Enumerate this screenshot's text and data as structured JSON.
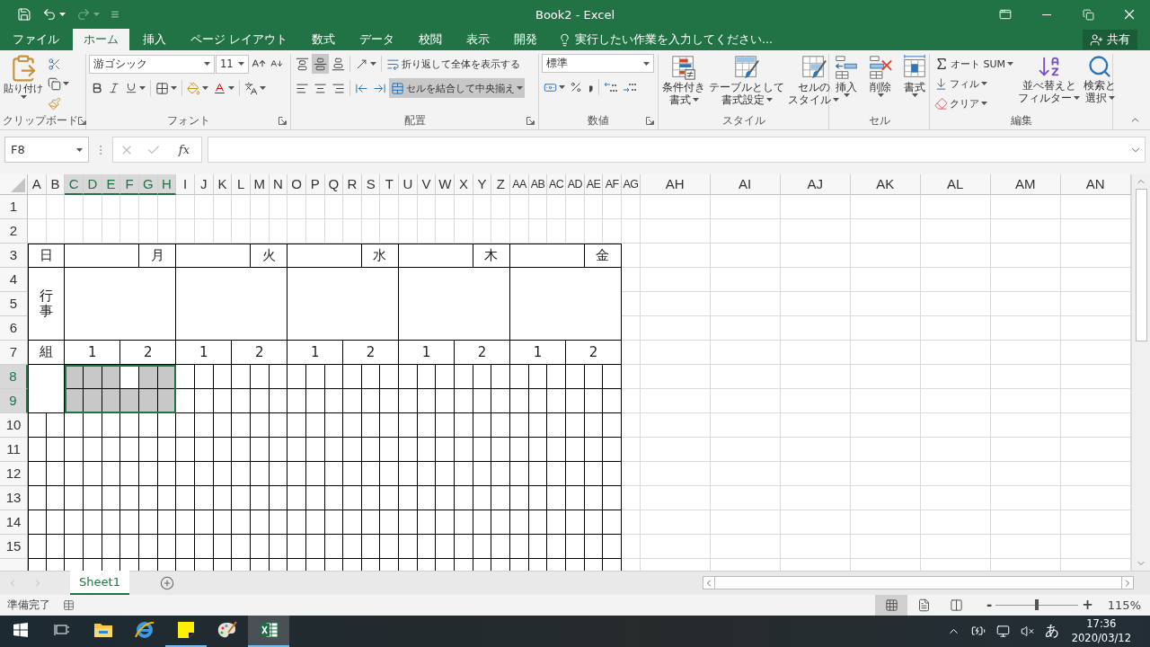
{
  "quick_access": [
    {
      "kind": "save",
      "disabled": false
    },
    {
      "kind": "undo",
      "disabled": false
    },
    {
      "kind": "redo",
      "disabled": true
    },
    {
      "kind": "customize",
      "disabled": false
    }
  ],
  "title": "Book2 - Excel",
  "tabs": [
    {
      "label": "ファイル",
      "selected": false
    },
    {
      "label": "ホーム",
      "selected": true
    },
    {
      "label": "挿入",
      "selected": false
    },
    {
      "label": "ページ レイアウト",
      "selected": false
    },
    {
      "label": "数式",
      "selected": false
    },
    {
      "label": "データ",
      "selected": false
    },
    {
      "label": "校閲",
      "selected": false
    },
    {
      "label": "表示",
      "selected": false
    },
    {
      "label": "開発",
      "selected": false
    }
  ],
  "tell_me": "実行したい作業を入力してください...",
  "share": "共有",
  "ribbon": {
    "clipboard": {
      "label": "クリップボード",
      "paste": "貼り付け"
    },
    "font": {
      "label": "フォント",
      "font_name": "游ゴシック",
      "font_size": "11"
    },
    "alignment": {
      "label": "配置",
      "vertical": [
        {
          "kind": "top",
          "selected": false
        },
        {
          "kind": "middle",
          "selected": true
        },
        {
          "kind": "bottom",
          "selected": false
        }
      ],
      "horizontal": [
        {
          "kind": "left",
          "selected": false
        },
        {
          "kind": "center",
          "selected": false
        },
        {
          "kind": "right",
          "selected": false
        }
      ],
      "wrap": {
        "label": "折り返して全体を表示する",
        "selected": false
      },
      "merge": {
        "label": "セルを結合して中央揃え",
        "selected": true
      }
    },
    "number": {
      "label": "数値",
      "format": "標準"
    },
    "styles": {
      "label": "スタイル",
      "buttons": [
        {
          "kind": "conditional",
          "lines": [
            "条件付き",
            "書式"
          ]
        },
        {
          "kind": "table",
          "lines": [
            "テーブルとして",
            "書式設定"
          ]
        },
        {
          "kind": "cell_styles",
          "lines": [
            "セルの",
            "スタイル"
          ]
        }
      ]
    },
    "cells": {
      "label": "セル",
      "buttons": [
        {
          "kind": "insert",
          "label": "挿入"
        },
        {
          "kind": "delete",
          "label": "削除"
        },
        {
          "kind": "format",
          "label": "書式"
        }
      ]
    },
    "editing": {
      "label": "編集",
      "small": [
        {
          "kind": "autosum",
          "label": "オート SUM"
        },
        {
          "kind": "fill",
          "label": "フィル"
        },
        {
          "kind": "clear",
          "label": "クリア"
        }
      ],
      "big": [
        {
          "kind": "sort",
          "lines": [
            "並べ替えと",
            "フィルター"
          ]
        },
        {
          "kind": "find",
          "lines": [
            "検索と",
            "選択"
          ]
        }
      ]
    }
  },
  "formula_bar": {
    "name_box": "F8",
    "fx": "fx"
  },
  "sheet": {
    "columns": [
      {
        "label": "A",
        "selected": false
      },
      {
        "label": "B",
        "selected": false
      },
      {
        "label": "C",
        "selected": true
      },
      {
        "label": "D",
        "selected": true
      },
      {
        "label": "E",
        "selected": true
      },
      {
        "label": "F",
        "selected": true
      },
      {
        "label": "G",
        "selected": true
      },
      {
        "label": "H",
        "selected": true
      },
      {
        "label": "I",
        "selected": false
      },
      {
        "label": "J",
        "selected": false
      },
      {
        "label": "K",
        "selected": false
      },
      {
        "label": "L",
        "selected": false
      },
      {
        "label": "M",
        "selected": false
      },
      {
        "label": "N",
        "selected": false
      },
      {
        "label": "O",
        "selected": false
      },
      {
        "label": "P",
        "selected": false
      },
      {
        "label": "Q",
        "selected": false
      },
      {
        "label": "R",
        "selected": false
      },
      {
        "label": "S",
        "selected": false
      },
      {
        "label": "T",
        "selected": false
      },
      {
        "label": "U",
        "selected": false
      },
      {
        "label": "V",
        "selected": false
      },
      {
        "label": "W",
        "selected": false
      },
      {
        "label": "X",
        "selected": false
      },
      {
        "label": "Y",
        "selected": false
      },
      {
        "label": "Z",
        "selected": false
      },
      {
        "label": "AA",
        "selected": false
      },
      {
        "label": "AB",
        "selected": false
      },
      {
        "label": "AC",
        "selected": false
      },
      {
        "label": "AD",
        "selected": false
      },
      {
        "label": "AE",
        "selected": false
      },
      {
        "label": "AF",
        "selected": false
      },
      {
        "label": "AG",
        "selected": false
      },
      {
        "label": "AH",
        "selected": false
      },
      {
        "label": "AI",
        "selected": false
      },
      {
        "label": "AJ",
        "selected": false
      },
      {
        "label": "AK",
        "selected": false
      },
      {
        "label": "AL",
        "selected": false
      },
      {
        "label": "AM",
        "selected": false
      },
      {
        "label": "AN",
        "selected": false
      }
    ],
    "rows": [
      {
        "label": "1",
        "selected": false
      },
      {
        "label": "2",
        "selected": false
      },
      {
        "label": "3",
        "selected": false
      },
      {
        "label": "4",
        "selected": false
      },
      {
        "label": "5",
        "selected": false
      },
      {
        "label": "6",
        "selected": false
      },
      {
        "label": "7",
        "selected": false
      },
      {
        "label": "8",
        "selected": true
      },
      {
        "label": "9",
        "selected": true
      },
      {
        "label": "10",
        "selected": false
      },
      {
        "label": "11",
        "selected": false
      },
      {
        "label": "12",
        "selected": false
      },
      {
        "label": "13",
        "selected": false
      },
      {
        "label": "14",
        "selected": false
      },
      {
        "label": "15",
        "selected": false
      }
    ],
    "selection": [
      {
        "active": false
      },
      {
        "active": false
      },
      {
        "active": false
      },
      {
        "active": true
      },
      {
        "active": false
      },
      {
        "active": false
      },
      {
        "active": false
      },
      {
        "active": false
      },
      {
        "active": false
      },
      {
        "active": false
      },
      {
        "active": false
      },
      {
        "active": false
      }
    ],
    "table": {
      "day_label": "日",
      "event_label": "行事",
      "class_label": "組",
      "days": [
        {
          "name": "月",
          "classes": [
            "1",
            "2"
          ]
        },
        {
          "name": "火",
          "classes": [
            "1",
            "2"
          ]
        },
        {
          "name": "水",
          "classes": [
            "1",
            "2"
          ]
        },
        {
          "name": "木",
          "classes": [
            "1",
            "2"
          ]
        },
        {
          "name": "金",
          "classes": [
            "1",
            "2"
          ]
        }
      ]
    }
  },
  "sheet_tabs": [
    {
      "label": "Sheet1",
      "selected": true
    }
  ],
  "status_bar": {
    "status": "準備完了",
    "views": [
      {
        "kind": "normal",
        "selected": true
      },
      {
        "kind": "page_layout",
        "selected": false
      },
      {
        "kind": "page_break",
        "selected": false
      }
    ],
    "zoom_out": "-",
    "zoom_in": "+",
    "zoom": {
      "level": 0.5
    },
    "zoom_reading": "115%"
  },
  "taskbar": {
    "apps": [
      {
        "kind": "task_view",
        "running": false,
        "active": false
      },
      {
        "kind": "explorer",
        "running": false,
        "active": false
      },
      {
        "kind": "browser",
        "running": false,
        "active": false
      },
      {
        "kind": "sticky_notes",
        "running": true,
        "active": false
      },
      {
        "kind": "paint",
        "running": false,
        "active": false
      },
      {
        "kind": "excel",
        "running": true,
        "active": true
      }
    ],
    "ime": "あ",
    "time": "17:36",
    "date": "2020/03/12"
  }
}
